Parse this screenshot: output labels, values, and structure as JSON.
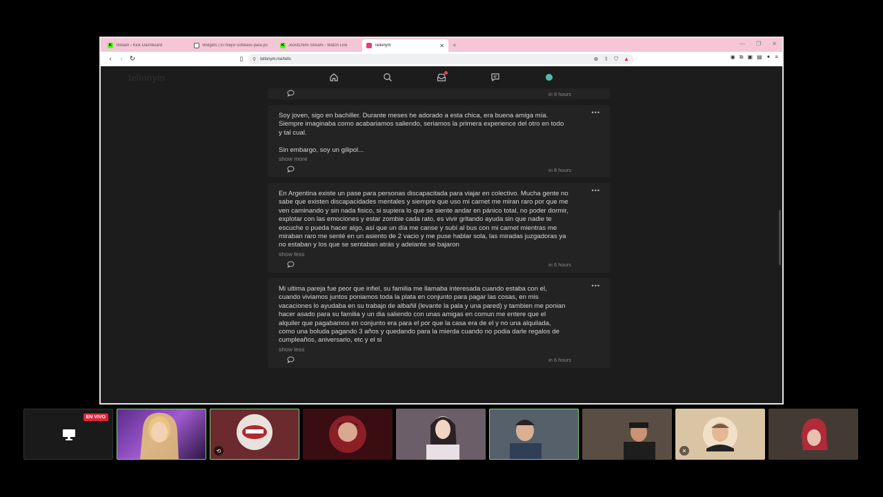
{
  "browser": {
    "tabs": [
      {
        "title": "Stream - Kick Dashboard",
        "fav_color": "#53fc18",
        "fav_text": "K"
      },
      {
        "title": "Widgets | El mejor software para po",
        "fav_color": "#ffffff",
        "fav_text": ""
      },
      {
        "title": "JoostChimi Stream - Watch Live",
        "fav_color": "#53fc18",
        "fav_text": "K"
      },
      {
        "title": "Tellonym",
        "fav_color": "#e83d6f",
        "fav_text": ""
      }
    ],
    "new_tab": "+",
    "url": "tellonym.me/tells",
    "accent": "#f4c6d6"
  },
  "app": {
    "brand": "tellonym"
  },
  "tells": [
    {
      "body": "",
      "toggle": "",
      "time": "in 8 hours"
    },
    {
      "body": "Soy joven, sigo en bachiller. Durante meses he adorado a esta chica, era buena amiga mía. Siempre imaginaba como acabariamos saliendo, seriamos la primera experience del otro en todo y tal cual.\n\nSin embargo, soy un gilipol...",
      "toggle": "show more",
      "time": "in 8 hours"
    },
    {
      "body": "En Argentina existe un pase para personas discapacitada para viajar en colectivo. Mucha gente no sabe que existen discapacidades mentales y siempre que uso mi carnet me miran raro por que me ven caminando y sin nada fisico, si supiera lo que se siente andar en pánico total, no poder dormir, explotar con las emociones y estar zombie cada rato, es vivir gritando ayuda sin que nadie te escuche o pueda hacer algo, así que un día me canse y subí al bus con mi carnet mientras me miraban raro me senté en un asiento de 2 vacio y me puse hablar sola, las miradas juzgadoras ya no estaban y los que se sentaban atrás y adelante se bajaron",
      "toggle": "show less",
      "time": "in 6 hours"
    },
    {
      "body": "Mi ultima pareja fue peor que infiel, su familia me llamaba interesada cuando estaba con el, cuando viviamos juntos poniamos toda la plata en conjunto para pagar las cosas, en mis vacaciones lo ayudaba en su trabajo de albañil (levante la pala y una pared) y tambien me ponian hacer asado para su familia y un dia saliendo con unas amigas en comun me entere que el alquiler que pagabamos en conjunto era para el por que la casa era de el y no una alquilada, como una boluda pagando 3 años y quedando para la mierda cuando no podia darle regalos de cumpleaños, aniversario, etc y el si",
      "toggle": "show less",
      "time": "in 6 hours"
    }
  ],
  "participants": [
    {
      "label": "EN VIVO",
      "bg": "#1a1a1a"
    },
    {
      "label": "",
      "bg": "#7a3fa8"
    },
    {
      "label": "",
      "bg": "#6b2a2e"
    },
    {
      "label": "",
      "bg": "#3a0d12"
    },
    {
      "label": "",
      "bg": "#5a4d55"
    },
    {
      "label": "",
      "bg": "#4d5a66"
    },
    {
      "label": "",
      "bg": "#4a4038"
    },
    {
      "label": "",
      "bg": "#d9c4a4"
    },
    {
      "label": "",
      "bg": "#3d3530"
    }
  ]
}
